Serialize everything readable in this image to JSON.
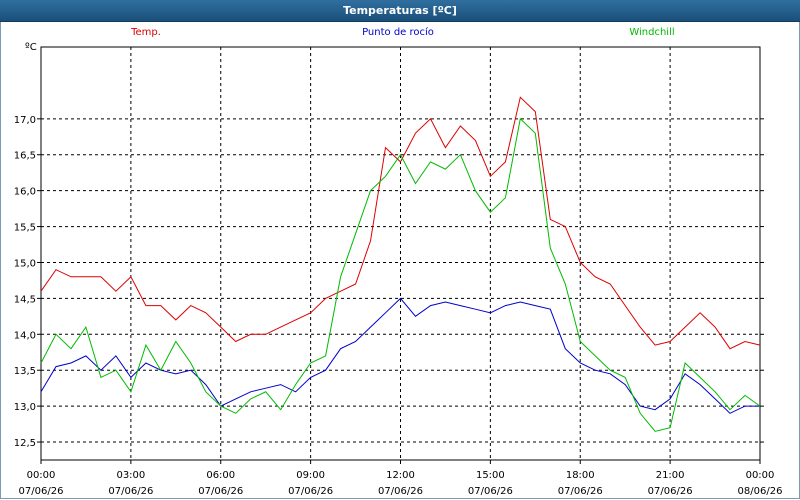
{
  "window": {
    "title": "Temperaturas [ºC]"
  },
  "chart_data": {
    "type": "line",
    "title": "Temperaturas [ºC]",
    "ylabel": "ºC",
    "xlabel": "",
    "ylim": [
      12.25,
      18.0
    ],
    "yticks": [
      "17,0",
      "16,5",
      "16,0",
      "15,5",
      "15,0",
      "14,5",
      "14,0",
      "13,5",
      "13,0",
      "12,5"
    ],
    "ytick_values": [
      17.0,
      16.5,
      16.0,
      15.5,
      15.0,
      14.5,
      14.0,
      13.5,
      13.0,
      12.5
    ],
    "xlim_hours": [
      0,
      24
    ],
    "xticks": [
      {
        "time": "00:00",
        "date": "07/06/26"
      },
      {
        "time": "03:00",
        "date": "07/06/26"
      },
      {
        "time": "06:00",
        "date": "07/06/26"
      },
      {
        "time": "09:00",
        "date": "07/06/26"
      },
      {
        "time": "12:00",
        "date": "07/06/26"
      },
      {
        "time": "15:00",
        "date": "07/06/26"
      },
      {
        "time": "18:00",
        "date": "07/06/26"
      },
      {
        "time": "21:00",
        "date": "07/06/26"
      },
      {
        "time": "00:00",
        "date": "08/06/26"
      }
    ],
    "grid": true,
    "series": [
      {
        "name": "Temp.",
        "color": "#dd0000",
        "x": [
          0,
          0.5,
          1,
          1.5,
          2,
          2.5,
          3,
          3.5,
          4,
          4.5,
          5,
          5.5,
          6,
          6.5,
          7,
          7.5,
          8,
          8.5,
          9,
          9.5,
          10,
          10.5,
          11,
          11.5,
          12,
          12.5,
          13,
          13.5,
          14,
          14.5,
          15,
          15.5,
          16,
          16.5,
          17,
          17.5,
          18,
          18.5,
          19,
          19.5,
          20,
          20.5,
          21,
          21.5,
          22,
          22.5,
          23,
          23.5,
          24
        ],
        "values": [
          14.6,
          14.9,
          14.8,
          14.8,
          14.8,
          14.6,
          14.8,
          14.4,
          14.4,
          14.2,
          14.4,
          14.3,
          14.1,
          13.9,
          14.0,
          14.0,
          14.1,
          14.2,
          14.3,
          14.5,
          14.6,
          14.7,
          15.3,
          16.6,
          16.4,
          16.8,
          17.0,
          16.6,
          16.9,
          16.7,
          16.2,
          16.4,
          17.3,
          17.1,
          15.6,
          15.5,
          15.0,
          14.8,
          14.7,
          14.4,
          14.1,
          13.85,
          13.9,
          14.1,
          14.3,
          14.1,
          13.8,
          13.9,
          13.85
        ]
      },
      {
        "name": "Punto de rocío",
        "color": "#0000cc",
        "x": [
          0,
          0.5,
          1,
          1.5,
          2,
          2.5,
          3,
          3.5,
          4,
          4.5,
          5,
          5.5,
          6,
          6.5,
          7,
          7.5,
          8,
          8.5,
          9,
          9.5,
          10,
          10.5,
          11,
          11.5,
          12,
          12.5,
          13,
          13.5,
          14,
          14.5,
          15,
          15.5,
          16,
          16.5,
          17,
          17.5,
          18,
          18.5,
          19,
          19.5,
          20,
          20.5,
          21,
          21.5,
          22,
          22.5,
          23,
          23.5,
          24
        ],
        "values": [
          13.2,
          13.55,
          13.6,
          13.7,
          13.5,
          13.7,
          13.4,
          13.6,
          13.5,
          13.45,
          13.5,
          13.3,
          13.0,
          13.1,
          13.2,
          13.25,
          13.3,
          13.2,
          13.4,
          13.5,
          13.8,
          13.9,
          14.1,
          14.3,
          14.5,
          14.25,
          14.4,
          14.45,
          14.4,
          14.35,
          14.3,
          14.4,
          14.45,
          14.4,
          14.35,
          13.8,
          13.6,
          13.5,
          13.45,
          13.3,
          13.0,
          12.95,
          13.1,
          13.45,
          13.3,
          13.1,
          12.9,
          13.0,
          13.0
        ]
      },
      {
        "name": "Windchill",
        "color": "#00bb00",
        "x": [
          0,
          0.5,
          1,
          1.5,
          2,
          2.5,
          3,
          3.5,
          4,
          4.5,
          5,
          5.5,
          6,
          6.5,
          7,
          7.5,
          8,
          8.5,
          9,
          9.5,
          10,
          10.5,
          11,
          11.5,
          12,
          12.5,
          13,
          13.5,
          14,
          14.5,
          15,
          15.5,
          16,
          16.5,
          17,
          17.5,
          18,
          18.5,
          19,
          19.5,
          20,
          20.5,
          21,
          21.5,
          22,
          22.5,
          23,
          23.5,
          24
        ],
        "values": [
          13.6,
          14.0,
          13.8,
          14.1,
          13.4,
          13.5,
          13.2,
          13.85,
          13.5,
          13.9,
          13.6,
          13.2,
          13.0,
          12.9,
          13.1,
          13.2,
          12.95,
          13.3,
          13.6,
          13.7,
          14.8,
          15.4,
          16.0,
          16.2,
          16.5,
          16.1,
          16.4,
          16.3,
          16.5,
          16.0,
          15.7,
          15.9,
          17.0,
          16.8,
          15.2,
          14.7,
          13.9,
          13.7,
          13.5,
          13.4,
          12.9,
          12.65,
          12.7,
          13.6,
          13.4,
          13.2,
          12.95,
          13.15,
          13.0
        ]
      }
    ]
  }
}
